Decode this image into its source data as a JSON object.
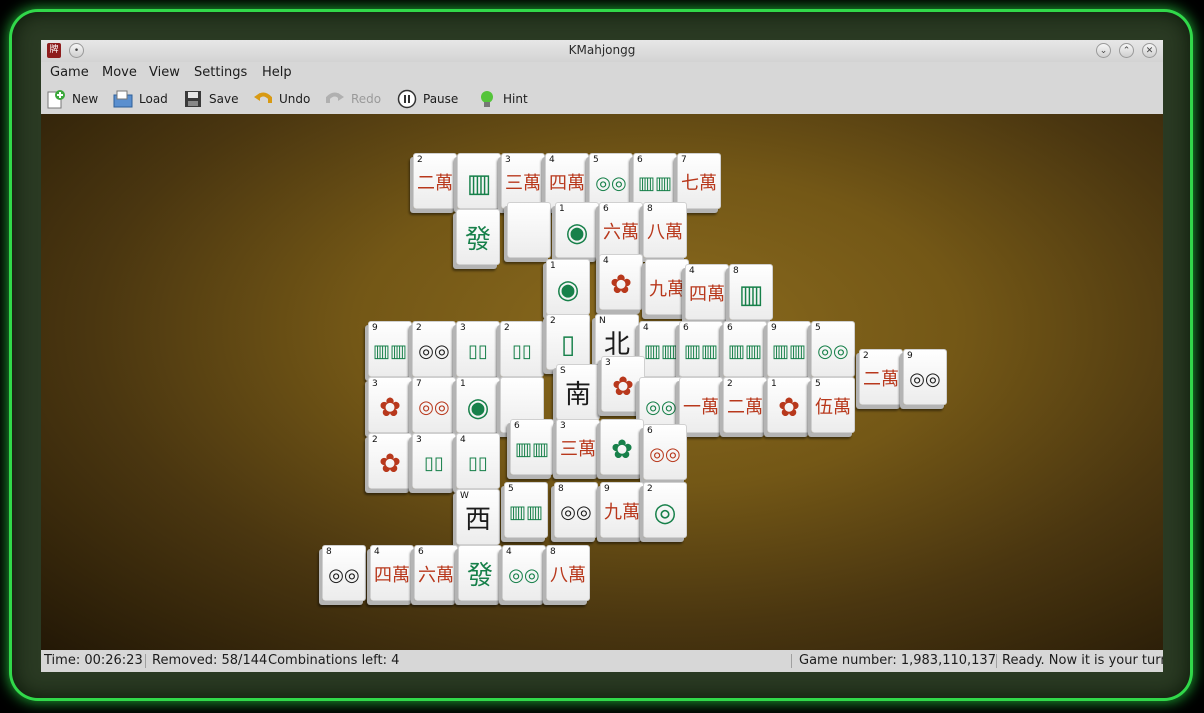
{
  "window": {
    "title": "KMahjongg"
  },
  "menu": [
    "Game",
    "Move",
    "View",
    "Settings",
    "Help"
  ],
  "toolbar": {
    "new": "New",
    "load": "Load",
    "save": "Save",
    "undo": "Undo",
    "redo": "Redo",
    "pause": "Pause",
    "hint": "Hint"
  },
  "status": {
    "time": "Time: 00:26:23",
    "removed": "Removed: 58/144",
    "combinations": "Combinations left: 4",
    "game_number": "Game number: 1,983,110,137",
    "message": "Ready. Now it is your turn."
  },
  "tiles": [
    {
      "n": "2",
      "g": "二萬",
      "c": "red"
    },
    {
      "n": "",
      "g": "▥",
      "c": "green"
    },
    {
      "n": "3",
      "g": "三萬",
      "c": "red"
    },
    {
      "n": "4",
      "g": "四萬",
      "c": "red"
    },
    {
      "n": "5",
      "g": "◎◎",
      "c": "green"
    },
    {
      "n": "6",
      "g": "▥▥",
      "c": "green"
    },
    {
      "n": "7",
      "g": "七萬",
      "c": "red"
    },
    {
      "n": "",
      "g": "發",
      "c": "green"
    },
    {
      "n": "",
      "g": "",
      "c": "blk"
    },
    {
      "n": "1",
      "g": "◉",
      "c": "green"
    },
    {
      "n": "6",
      "g": "六萬",
      "c": "red"
    },
    {
      "n": "8",
      "g": "八萬",
      "c": "red"
    },
    {
      "n": "1",
      "g": "◉",
      "c": "green"
    },
    {
      "n": "4",
      "g": "✿",
      "c": "red"
    },
    {
      "n": "",
      "g": "九萬",
      "c": "red"
    },
    {
      "n": "4",
      "g": "四萬",
      "c": "red"
    },
    {
      "n": "8",
      "g": "▥",
      "c": "green"
    },
    {
      "n": "9",
      "g": "▥▥",
      "c": "green"
    },
    {
      "n": "2",
      "g": "◎◎",
      "c": "blk"
    },
    {
      "n": "3",
      "g": "▯▯",
      "c": "green"
    },
    {
      "n": "2",
      "g": "▯▯",
      "c": "green"
    },
    {
      "n": "2",
      "g": "▯",
      "c": "green"
    },
    {
      "n": "N",
      "g": "北",
      "c": "blk"
    },
    {
      "n": "4",
      "g": "▥▥",
      "c": "green"
    },
    {
      "n": "6",
      "g": "▥▥",
      "c": "green"
    },
    {
      "n": "6",
      "g": "▥▥",
      "c": "green"
    },
    {
      "n": "9",
      "g": "▥▥",
      "c": "green"
    },
    {
      "n": "5",
      "g": "◎◎",
      "c": "green"
    },
    {
      "n": "2",
      "g": "二萬",
      "c": "red"
    },
    {
      "n": "9",
      "g": "◎◎",
      "c": "blk"
    },
    {
      "n": "3",
      "g": "✿",
      "c": "red"
    },
    {
      "n": "7",
      "g": "◎◎",
      "c": "red"
    },
    {
      "n": "1",
      "g": "◉",
      "c": "green"
    },
    {
      "n": "",
      "g": "",
      "c": "blk"
    },
    {
      "n": "S",
      "g": "南",
      "c": "blk"
    },
    {
      "n": "3",
      "g": "✿",
      "c": "red"
    },
    {
      "n": "",
      "g": "◎◎",
      "c": "green"
    },
    {
      "n": "",
      "g": "一萬",
      "c": "red"
    },
    {
      "n": "2",
      "g": "二萬",
      "c": "red"
    },
    {
      "n": "1",
      "g": "✿",
      "c": "red"
    },
    {
      "n": "5",
      "g": "伍萬",
      "c": "red"
    },
    {
      "n": "2",
      "g": "✿",
      "c": "red"
    },
    {
      "n": "3",
      "g": "▯▯",
      "c": "green"
    },
    {
      "n": "4",
      "g": "▯▯",
      "c": "green"
    },
    {
      "n": "6",
      "g": "▥▥",
      "c": "green"
    },
    {
      "n": "3",
      "g": "三萬",
      "c": "red"
    },
    {
      "n": "",
      "g": "✿",
      "c": "green"
    },
    {
      "n": "6",
      "g": "◎◎",
      "c": "red"
    },
    {
      "n": "W",
      "g": "西",
      "c": "blk"
    },
    {
      "n": "5",
      "g": "▥▥",
      "c": "green"
    },
    {
      "n": "8",
      "g": "◎◎",
      "c": "blk"
    },
    {
      "n": "9",
      "g": "九萬",
      "c": "red"
    },
    {
      "n": "2",
      "g": "◎",
      "c": "green"
    },
    {
      "n": "8",
      "g": "◎◎",
      "c": "blk"
    },
    {
      "n": "4",
      "g": "四萬",
      "c": "red"
    },
    {
      "n": "6",
      "g": "六萬",
      "c": "red"
    },
    {
      "n": "",
      "g": "發",
      "c": "green"
    },
    {
      "n": "4",
      "g": "◎◎",
      "c": "green"
    },
    {
      "n": "8",
      "g": "八萬",
      "c": "red"
    }
  ]
}
